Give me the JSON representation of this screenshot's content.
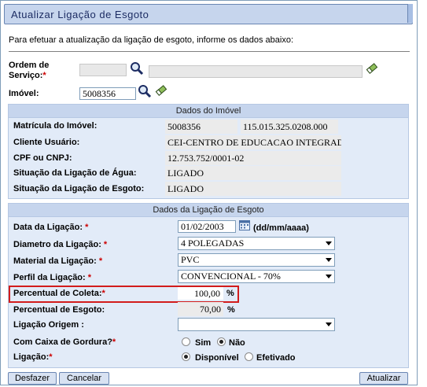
{
  "window": {
    "title": "Atualizar Ligação de Esgoto"
  },
  "intro_text": "Para efetuar a atualização da ligação de esgoto, informe os dados abaixo:",
  "ordem_servico": {
    "label": "Ordem de Serviço:",
    "required_mark": "*",
    "value": "",
    "description": ""
  },
  "imovel": {
    "label": "Imóvel:",
    "value": "5008356"
  },
  "dados_imovel": {
    "header": "Dados do Imóvel",
    "matricula": {
      "label": "Matrícula do Imóvel:",
      "value": "5008356",
      "inscricao": "115.015.325.0208.000"
    },
    "cliente": {
      "label": "Cliente Usuário:",
      "value": "CEI-CENTRO DE EDUCACAO INTEGRADA L"
    },
    "cpf_cnpj": {
      "label": "CPF ou CNPJ:",
      "value": "12.753.752/0001-02"
    },
    "situacao_agua": {
      "label": "Situação da Ligação de Água:",
      "value": "LIGADO"
    },
    "situacao_esgoto": {
      "label": "Situação da Ligação de Esgoto:",
      "value": "LIGADO"
    }
  },
  "dados_ligacao": {
    "header": "Dados da Ligação de Esgoto",
    "data": {
      "label": "Data da Ligação:",
      "required_mark": "*",
      "value": "01/02/2003",
      "format_hint": "(dd/mm/aaaa)"
    },
    "diametro": {
      "label": "Diametro da Ligação:",
      "required_mark": "*",
      "value": "4 POLEGADAS"
    },
    "material": {
      "label": "Material da Ligação:",
      "required_mark": "*",
      "value": "PVC"
    },
    "perfil": {
      "label": "Perfil da Ligação:",
      "required_mark": "*",
      "value": "CONVENCIONAL - 70%"
    },
    "percentual_coleta": {
      "label": "Percentual de Coleta:",
      "required_mark": "*",
      "value": "100,00",
      "unit": "%"
    },
    "percentual_esgoto": {
      "label": "Percentual de Esgoto:",
      "value": "70,00",
      "unit": "%"
    },
    "ligacao_origem": {
      "label": "Ligação Origem :",
      "value": ""
    },
    "caixa_gordura": {
      "label": "Com Caixa de Gordura?",
      "required_mark": "*",
      "options": [
        "Sim",
        "Não"
      ],
      "selected": "Não"
    },
    "ligacao": {
      "label": "Ligação:",
      "required_mark": "*",
      "options": [
        "Disponível",
        "Efetivado"
      ],
      "selected": "Disponível"
    }
  },
  "buttons": {
    "desfazer": "Desfazer",
    "cancelar": "Cancelar",
    "atualizar": "Atualizar"
  },
  "colors": {
    "highlight": "#d21c1c",
    "panel": "#e2ebf8",
    "title_bar": "#c6d5ed"
  }
}
